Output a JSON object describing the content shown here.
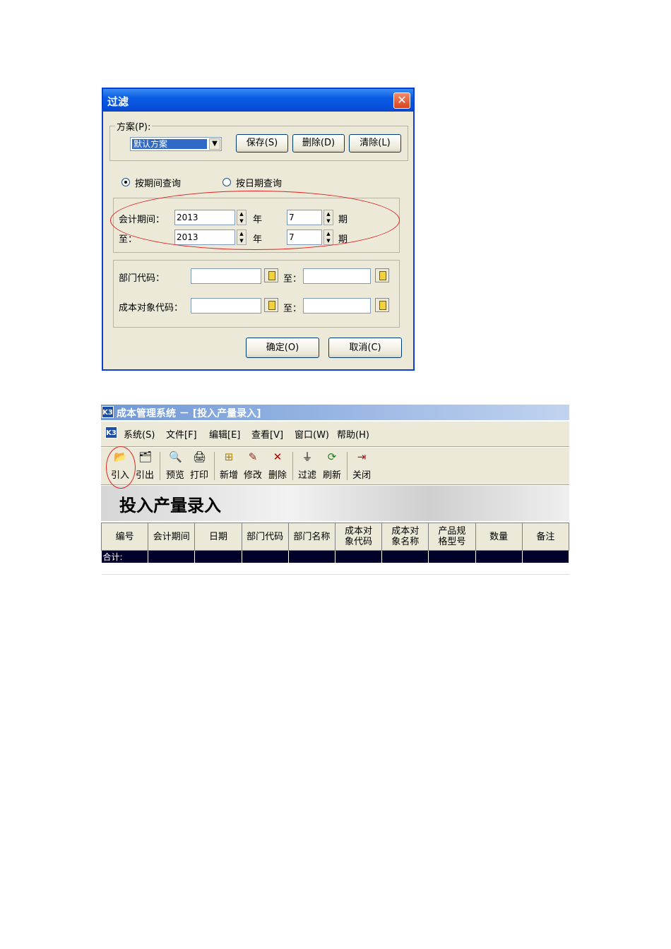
{
  "filter_dialog": {
    "title": "过滤",
    "close_glyph": "✕",
    "scheme": {
      "label": "方案(P):",
      "selected": "默认方案",
      "save_label": "保存(S)",
      "delete_label": "删除(D)",
      "clear_label": "清除(L)"
    },
    "query_mode": {
      "by_period_label": "按期间查询",
      "by_date_label": "按日期查询",
      "selected": "by_period"
    },
    "period": {
      "from_label": "会计期间：",
      "to_label": "至：",
      "year_unit": "年",
      "period_unit": "期",
      "from_year": "2013",
      "from_period": "7",
      "to_year": "2013",
      "to_period": "7"
    },
    "codes": {
      "dept_label": "部门代码：",
      "cost_obj_label": "成本对象代码：",
      "to_label": "至："
    },
    "ok_label": "确定(O)",
    "cancel_label": "取消(C)"
  },
  "app_window": {
    "title": "成本管理系统 － [投入产量录入]",
    "logo_text": "K3",
    "menu": [
      "系统(S)",
      "文件[F]",
      "编辑[E]",
      "查看[V]",
      "窗口(W)",
      "帮助(H)"
    ],
    "toolbar": [
      {
        "label": "引入",
        "icon": "import-icon"
      },
      {
        "label": "引出",
        "icon": "export-icon"
      },
      {
        "label": "预览",
        "icon": "preview-icon"
      },
      {
        "label": "打印",
        "icon": "print-icon"
      },
      {
        "label": "新增",
        "icon": "add-icon"
      },
      {
        "label": "修改",
        "icon": "edit-icon"
      },
      {
        "label": "删除",
        "icon": "delete-icon"
      },
      {
        "label": "过滤",
        "icon": "filter-icon"
      },
      {
        "label": "刷新",
        "icon": "refresh-icon"
      },
      {
        "label": "关闭",
        "icon": "close-door-icon"
      }
    ],
    "banner_title": "投入产量录入",
    "columns": [
      "编号",
      "会计期间",
      "日期",
      "部门代码",
      "部门名称",
      "成本对象代码",
      "成本对象名称",
      "产品规格型号",
      "数量",
      "备注"
    ],
    "total_label": "合计:"
  }
}
